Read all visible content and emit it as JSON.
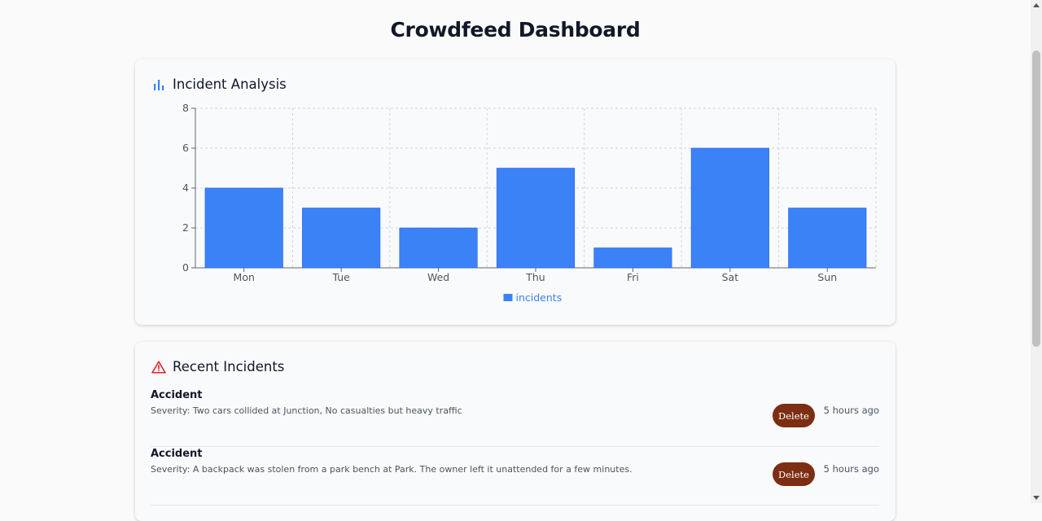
{
  "page": {
    "title": "Crowdfeed Dashboard"
  },
  "colors": {
    "bar": "#3b82f6",
    "delete_button": "#7c2d12",
    "alert": "#dc2626"
  },
  "analysis": {
    "title": "Incident Analysis",
    "icon": "bar-chart-icon",
    "chart_data": {
      "type": "bar",
      "categories": [
        "Mon",
        "Tue",
        "Wed",
        "Thu",
        "Fri",
        "Sat",
        "Sun"
      ],
      "series": [
        {
          "name": "incidents",
          "values": [
            4,
            3,
            2,
            5,
            1,
            6,
            3
          ]
        }
      ],
      "ylim": [
        0,
        8
      ],
      "yticks": [
        "0",
        "2",
        "4",
        "6",
        "8"
      ],
      "grid": true,
      "legend": "bottom-center"
    }
  },
  "recent": {
    "title": "Recent Incidents",
    "icon": "alert-triangle-icon",
    "items": [
      {
        "title": "Accident",
        "description": "Severity: Two cars collided at Junction, No casualties but heavy traffic",
        "action": "Delete",
        "time": "5 hours ago"
      },
      {
        "title": "Accident",
        "description": "Severity: A backpack was stolen from a park bench at Park. The owner left it unattended for a few minutes.",
        "action": "Delete",
        "time": "5 hours ago"
      }
    ]
  }
}
